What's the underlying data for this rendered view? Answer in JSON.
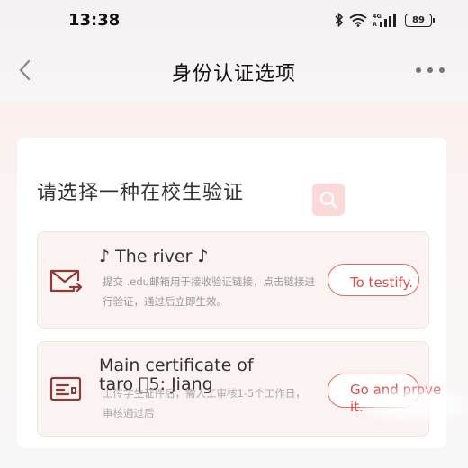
{
  "status_bar": {
    "time": "13:38",
    "battery": "89",
    "network": "4G",
    "icons": [
      "bluetooth-icon",
      "wifi-icon",
      "signal-icon",
      "battery-icon"
    ]
  },
  "nav": {
    "title": "身份认证选项",
    "back_icon": "chevron-left-icon",
    "more_icon": "more-dots-icon"
  },
  "card": {
    "title": "请选择一种在校生验证",
    "search_icon": "search-icon",
    "accent_color": "#e34a4a",
    "options": [
      {
        "icon": "mail-forward-icon",
        "title": "♪ The river ♪",
        "description": "提交 .edu邮箱用于接收验证链接，点击链接进行验证，通过后立即生效。",
        "button": "To testify."
      },
      {
        "icon": "id-card-icon",
        "title": "Main certificate of taro ゙5: Jiang",
        "description": "上传学生证件后，需人工审核1-5个工作日，审核通过后",
        "button": "Go and prove it."
      }
    ]
  }
}
